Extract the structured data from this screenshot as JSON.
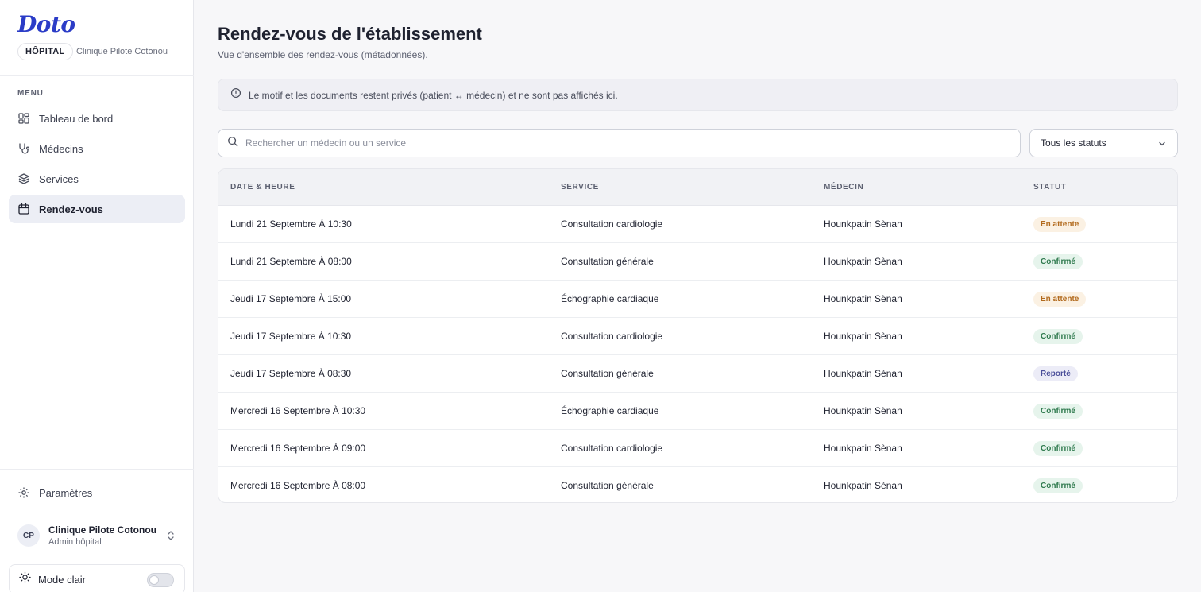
{
  "app": {
    "logo": "Doto",
    "role_badge": "HÔPITAL",
    "clinic_name": "Clinique Pilote Cotonou"
  },
  "sidebar": {
    "menu_label": "MENU",
    "items": [
      {
        "label": "Tableau de bord",
        "icon": "dashboard-icon"
      },
      {
        "label": "Médecins",
        "icon": "stethoscope-icon"
      },
      {
        "label": "Services",
        "icon": "layers-icon"
      },
      {
        "label": "Rendez-vous",
        "icon": "calendar-icon",
        "active": true
      }
    ],
    "settings_label": "Paramètres",
    "profile": {
      "initials": "CP",
      "name": "Clinique Pilote Cotonou",
      "role": "Admin hôpital"
    },
    "mode_label": "Mode clair"
  },
  "main": {
    "title": "Rendez-vous de l'établissement",
    "subtitle": "Vue d'ensemble des rendez-vous (métadonnées).",
    "info_banner": "Le motif et les documents restent privés (patient ↔ médecin) et ne sont pas affichés ici.",
    "search_placeholder": "Rechercher un médecin ou un service",
    "status_filter": "Tous les statuts",
    "table": {
      "headers": [
        "DATE & HEURE",
        "SERVICE",
        "MÉDECIN",
        "STATUT"
      ],
      "rows": [
        {
          "date": "Lundi 21 Septembre À 10:30",
          "service": "Consultation cardiologie",
          "doctor": "Hounkpatin Sènan",
          "status": "En attente"
        },
        {
          "date": "Lundi 21 Septembre À 08:00",
          "service": "Consultation générale",
          "doctor": "Hounkpatin Sènan",
          "status": "Confirmé"
        },
        {
          "date": "Jeudi 17 Septembre À 15:00",
          "service": "Échographie cardiaque",
          "doctor": "Hounkpatin Sènan",
          "status": "En attente"
        },
        {
          "date": "Jeudi 17 Septembre À 10:30",
          "service": "Consultation cardiologie",
          "doctor": "Hounkpatin Sènan",
          "status": "Confirmé"
        },
        {
          "date": "Jeudi 17 Septembre À 08:30",
          "service": "Consultation générale",
          "doctor": "Hounkpatin Sènan",
          "status": "Reporté"
        },
        {
          "date": "Mercredi 16 Septembre À 10:30",
          "service": "Échographie cardiaque",
          "doctor": "Hounkpatin Sènan",
          "status": "Confirmé"
        },
        {
          "date": "Mercredi 16 Septembre À 09:00",
          "service": "Consultation cardiologie",
          "doctor": "Hounkpatin Sènan",
          "status": "Confirmé"
        },
        {
          "date": "Mercredi 16 Septembre À 08:00",
          "service": "Consultation générale",
          "doctor": "Hounkpatin Sènan",
          "status": "Confirmé"
        }
      ]
    }
  },
  "colors": {
    "brand": "#2b3cc7",
    "pending": "#b26a1d",
    "confirmed": "#2f7a4e",
    "postponed": "#4b4f9a"
  }
}
